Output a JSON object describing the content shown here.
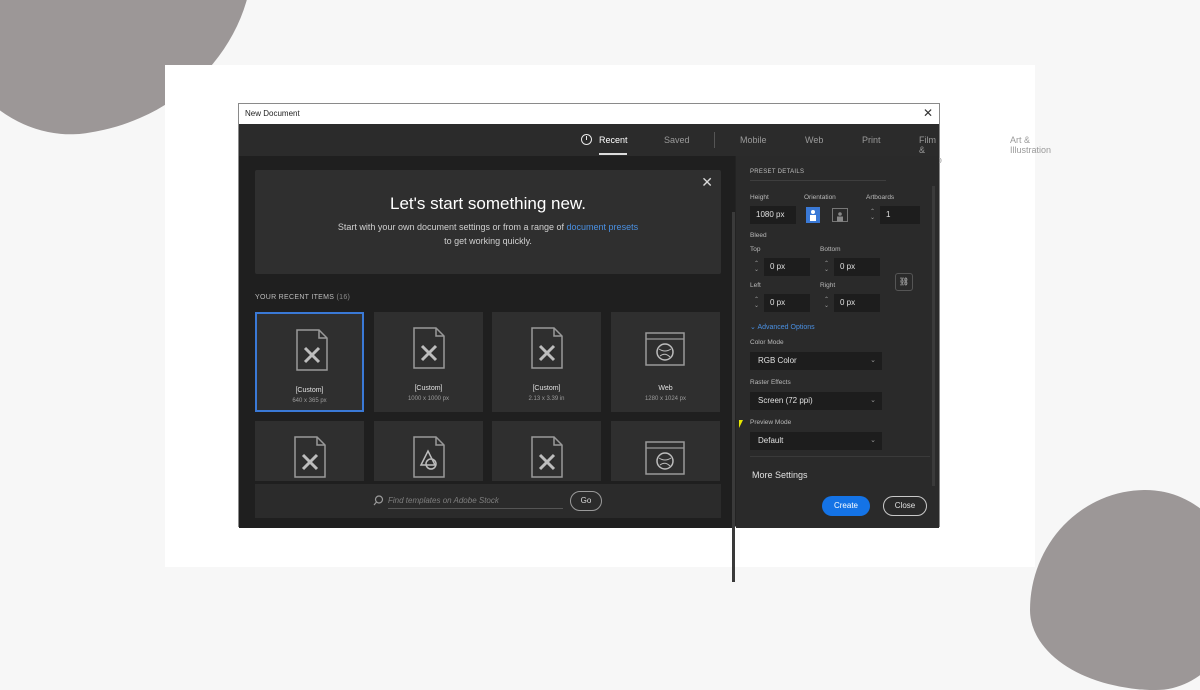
{
  "window": {
    "title": "New Document"
  },
  "tabs": [
    {
      "label": "Recent",
      "active": true
    },
    {
      "label": "Saved"
    },
    {
      "label": "Mobile"
    },
    {
      "label": "Web"
    },
    {
      "label": "Print"
    },
    {
      "label": "Film & Video"
    },
    {
      "label": "Art & Illustration"
    }
  ],
  "welcome": {
    "title": "Let's start something new.",
    "line1_pre": "Start with your own document settings or from a range of ",
    "line1_link": "document presets",
    "line2": "to get working quickly."
  },
  "recent": {
    "header": "YOUR RECENT ITEMS",
    "count": "(16)",
    "items": [
      {
        "name": "[Custom]",
        "size": "640 x 365 px",
        "icon": "pen-document-icon",
        "selected": true
      },
      {
        "name": "[Custom]",
        "size": "1000 x 1000 px",
        "icon": "pen-document-icon"
      },
      {
        "name": "[Custom]",
        "size": "2.13 x 3.39 in",
        "icon": "pen-document-icon"
      },
      {
        "name": "Web",
        "size": "1280 x 1024 px",
        "icon": "web-globe-icon"
      },
      {
        "icon": "pen-document-icon"
      },
      {
        "icon": "shapes-document-icon"
      },
      {
        "icon": "pen-document-icon"
      },
      {
        "icon": "web-globe-icon"
      }
    ]
  },
  "search": {
    "placeholder": "Find templates on Adobe Stock",
    "go": "Go"
  },
  "preset": {
    "header": "PRESET DETAILS",
    "height_label": "Height",
    "height_value": "1080 px",
    "orientation_label": "Orientation",
    "artboards_label": "Artboards",
    "artboards_value": "1",
    "bleed_label": "Bleed",
    "top_label": "Top",
    "top_value": "0 px",
    "bottom_label": "Bottom",
    "bottom_value": "0 px",
    "left_label": "Left",
    "left_value": "0 px",
    "right_label": "Right",
    "right_value": "0 px",
    "advanced": "Advanced Options",
    "color_mode_label": "Color Mode",
    "color_mode_value": "RGB Color",
    "raster_label": "Raster Effects",
    "raster_value": "Screen (72 ppi)",
    "preview_label": "Preview Mode",
    "preview_value": "Default",
    "more_settings": "More Settings"
  },
  "buttons": {
    "create": "Create",
    "close": "Close"
  },
  "colors": {
    "accent": "#1473e6",
    "link": "#4a90e2",
    "selection": "#3a79d6"
  }
}
